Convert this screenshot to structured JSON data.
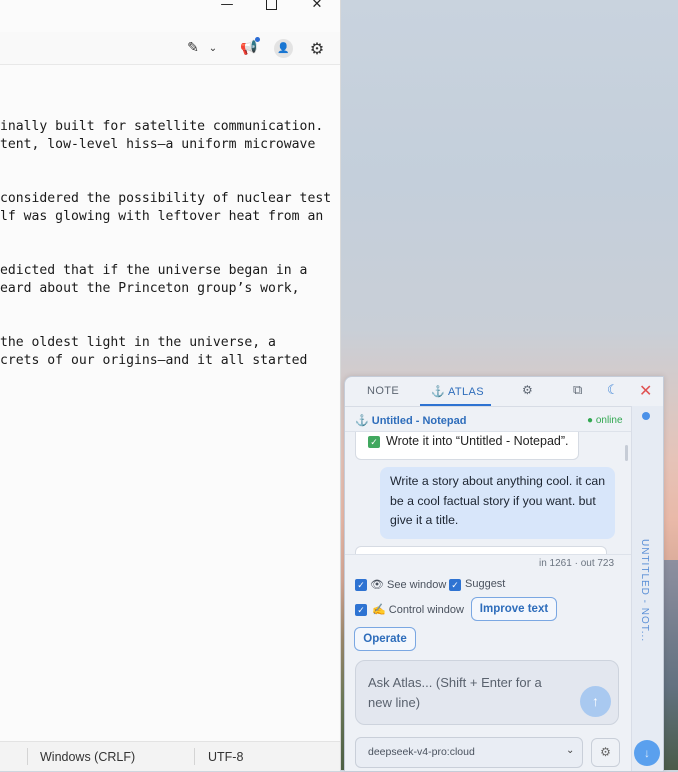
{
  "notepad": {
    "toolbar": {
      "pen_icon": "✎",
      "chevron_icon": "⌄",
      "announce_icon": "📢",
      "user_icon": "👤",
      "settings_icon": "⚙"
    },
    "window_controls": {
      "minimize": "—",
      "close": "✕"
    },
    "lines": [
      "inally built for satellite communication.",
      "tent, low-level hiss—a uniform microwave",
      "considered the possibility of nuclear test",
      "lf was glowing with leftover heat from an",
      "edicted that if the universe began in a",
      "eard about the Princeton group’s work,",
      "the oldest light in the universe, a",
      "crets of our origins—and it all started"
    ],
    "status": {
      "line_endings": "Windows (CRLF)",
      "encoding": "UTF-8"
    }
  },
  "atlas": {
    "tabs": {
      "note": "NOTE",
      "atlas": "⚓ ATLAS",
      "settings_icon": "⚙",
      "window_icon": "⧉",
      "theme_icon": "☾",
      "close_icon": "✕"
    },
    "context": {
      "target": "⚓ Untitled - Notepad",
      "status": "● online"
    },
    "messages": {
      "system": "Wrote it into “Untitled - Notepad”.",
      "user": "Write a story about anything cool. it can be a cool factual story if you want. but give it a title."
    },
    "tokens": "in 1261 · out 723",
    "options": {
      "see_window": "👁 See window",
      "suggest": "Suggest",
      "control_window": "✍ Control window",
      "improve_text": "Improve text",
      "operate": "Operate"
    },
    "input": {
      "placeholder": "Ask Atlas...  (Shift + Enter for a new line)",
      "send_icon": "↑"
    },
    "model": {
      "selected": "deepseek-v4-pro:cloud",
      "settings_icon": "⚙"
    },
    "side": {
      "window_name": "UNTITLED - NOT..."
    }
  }
}
